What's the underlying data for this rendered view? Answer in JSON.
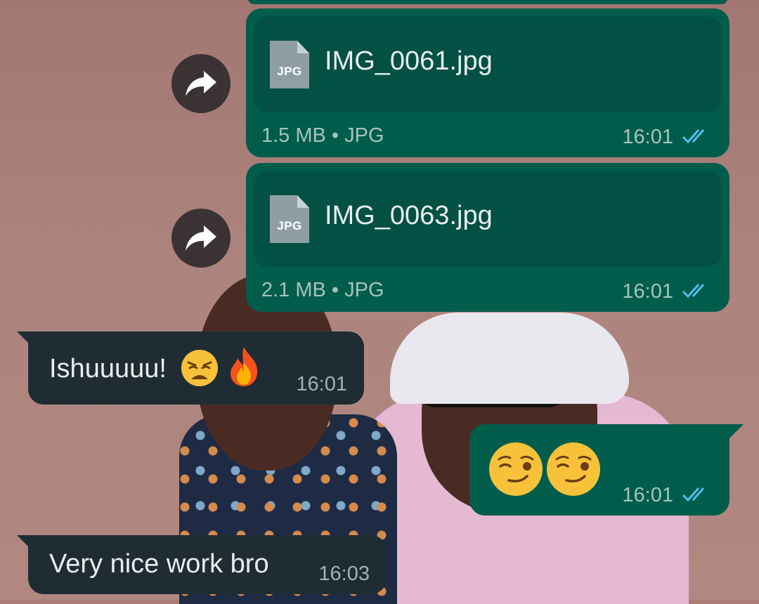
{
  "messages": {
    "file1": {
      "name": "IMG_0061.jpg",
      "type_badge": "JPG",
      "meta": "1.5 MB • JPG",
      "time": "16:01"
    },
    "file2": {
      "name": "IMG_0063.jpg",
      "type_badge": "JPG",
      "meta": "2.1 MB • JPG",
      "time": "16:01"
    },
    "incoming1": {
      "text": "Ishuuuuu!",
      "time": "16:01"
    },
    "outgoing_emoji": {
      "time": "16:01"
    },
    "incoming2": {
      "text": "Very nice work bro",
      "time": "16:03"
    }
  },
  "icons": {
    "forward": "forward-arrow-icon",
    "read_receipt": "double-check-icon",
    "file": "jpg-file-icon",
    "emoji_weary": "weary-face-emoji",
    "emoji_fire": "fire-emoji",
    "emoji_wink": "winking-face-emoji"
  },
  "colors": {
    "outgoing_bubble": "#005c4b",
    "incoming_bubble": "#202c33",
    "read_tick": "#53bdeb"
  }
}
